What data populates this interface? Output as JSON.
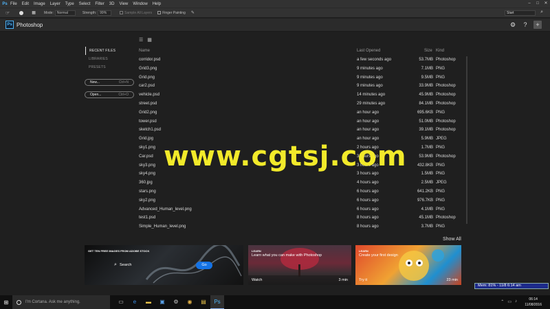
{
  "menubar": {
    "logo": "Ps",
    "items": [
      "File",
      "Edit",
      "Image",
      "Layer",
      "Type",
      "Select",
      "Filter",
      "3D",
      "View",
      "Window",
      "Help"
    ]
  },
  "options": {
    "mode_label": "Mode:",
    "mode_value": "Normal",
    "strength_label": "Strength:",
    "strength_value": "99%",
    "sample_all": "Sample All Layers",
    "finger_painting": "Finger Painting",
    "workspace": "Start"
  },
  "header": {
    "logo": "Ps",
    "title": "Photoshop"
  },
  "nav": {
    "items": [
      "RECENT FILES",
      "LIBRARIES",
      "PRESETS"
    ]
  },
  "buttons": {
    "new_label": "New...",
    "new_shortcut": "Ctrl+N",
    "open_label": "Open...",
    "open_shortcut": "Ctrl+O"
  },
  "table": {
    "headers": {
      "name": "Name",
      "last_opened": "Last Opened",
      "size": "Size",
      "kind": "Kind"
    },
    "rows": [
      {
        "name": "corridor.psd",
        "opened": "a few seconds ago",
        "size": "53.7MB",
        "kind": "Photoshop"
      },
      {
        "name": "Grid3.png",
        "opened": "9 minutes ago",
        "size": "7.1MB",
        "kind": "PNG"
      },
      {
        "name": "Grid.png",
        "opened": "9 minutes ago",
        "size": "9.5MB",
        "kind": "PNG"
      },
      {
        "name": "car2.psd",
        "opened": "9 minutes ago",
        "size": "33.9MB",
        "kind": "Photoshop"
      },
      {
        "name": "vehicle.psd",
        "opened": "14 minutes ago",
        "size": "45.9MB",
        "kind": "Photoshop"
      },
      {
        "name": "street.psd",
        "opened": "29 minutes ago",
        "size": "84.1MB",
        "kind": "Photoshop"
      },
      {
        "name": "Grid2.png",
        "opened": "an hour ago",
        "size": "695.6KB",
        "kind": "PNG"
      },
      {
        "name": "tower.psd",
        "opened": "an hour ago",
        "size": "51.0MB",
        "kind": "Photoshop"
      },
      {
        "name": "sketch1.psd",
        "opened": "an hour ago",
        "size": "39.1MB",
        "kind": "Photoshop"
      },
      {
        "name": "Grid.jpg",
        "opened": "an hour ago",
        "size": "5.9MB",
        "kind": "JPEG"
      },
      {
        "name": "sky1.png",
        "opened": "2 hours ago",
        "size": "1.7MB",
        "kind": "PNG"
      },
      {
        "name": "Car.psd",
        "opened": "3 hours ago",
        "size": "53.9MB",
        "kind": "Photoshop"
      },
      {
        "name": "sky3.png",
        "opened": "3 hours ago",
        "size": "432.8KB",
        "kind": "PNG"
      },
      {
        "name": "sky4.png",
        "opened": "3 hours ago",
        "size": "1.5MB",
        "kind": "PNG"
      },
      {
        "name": "360.jpg",
        "opened": "4 hours ago",
        "size": "2.5MB",
        "kind": "JPEG"
      },
      {
        "name": "stars.png",
        "opened": "6 hours ago",
        "size": "641.2KB",
        "kind": "PNG"
      },
      {
        "name": "sky2.png",
        "opened": "6 hours ago",
        "size": "976.7KB",
        "kind": "PNG"
      },
      {
        "name": "Advanced_Human_level.png",
        "opened": "6 hours ago",
        "size": "4.1MB",
        "kind": "PNG"
      },
      {
        "name": "test1.psd",
        "opened": "8 hours ago",
        "size": "45.1MB",
        "kind": "Photoshop"
      },
      {
        "name": "Simple_Human_level.png",
        "opened": "8 hours ago",
        "size": "3.7MB",
        "kind": "PNG"
      }
    ]
  },
  "show_all": "Show All",
  "cards": {
    "stock_title": "GET TEN FREE IMAGES FROM ADOBE STOCK",
    "stock_search": "Search",
    "stock_go": "Go",
    "learn1_tag": "LEARN",
    "learn1_title": "Learn what you can make with Photoshop",
    "learn1_action": "Watch",
    "learn1_duration": "3 min",
    "learn2_tag": "LEARN",
    "learn2_title": "Create your first design",
    "learn2_action": "Try it",
    "learn2_duration": "23 min"
  },
  "mem": "Mem: 81% - 11/8  6:14 am",
  "taskbar": {
    "cortana": "I'm Cortana. Ask me anything.",
    "time": "06:14",
    "date": "11/08/2016"
  },
  "watermark": "www.cgtsj.com",
  "colors": {
    "accent": "#1473e6",
    "ps_blue": "#4fb3f6",
    "watermark": "#f2ea2a",
    "mem_bg": "#1d2a8a"
  }
}
